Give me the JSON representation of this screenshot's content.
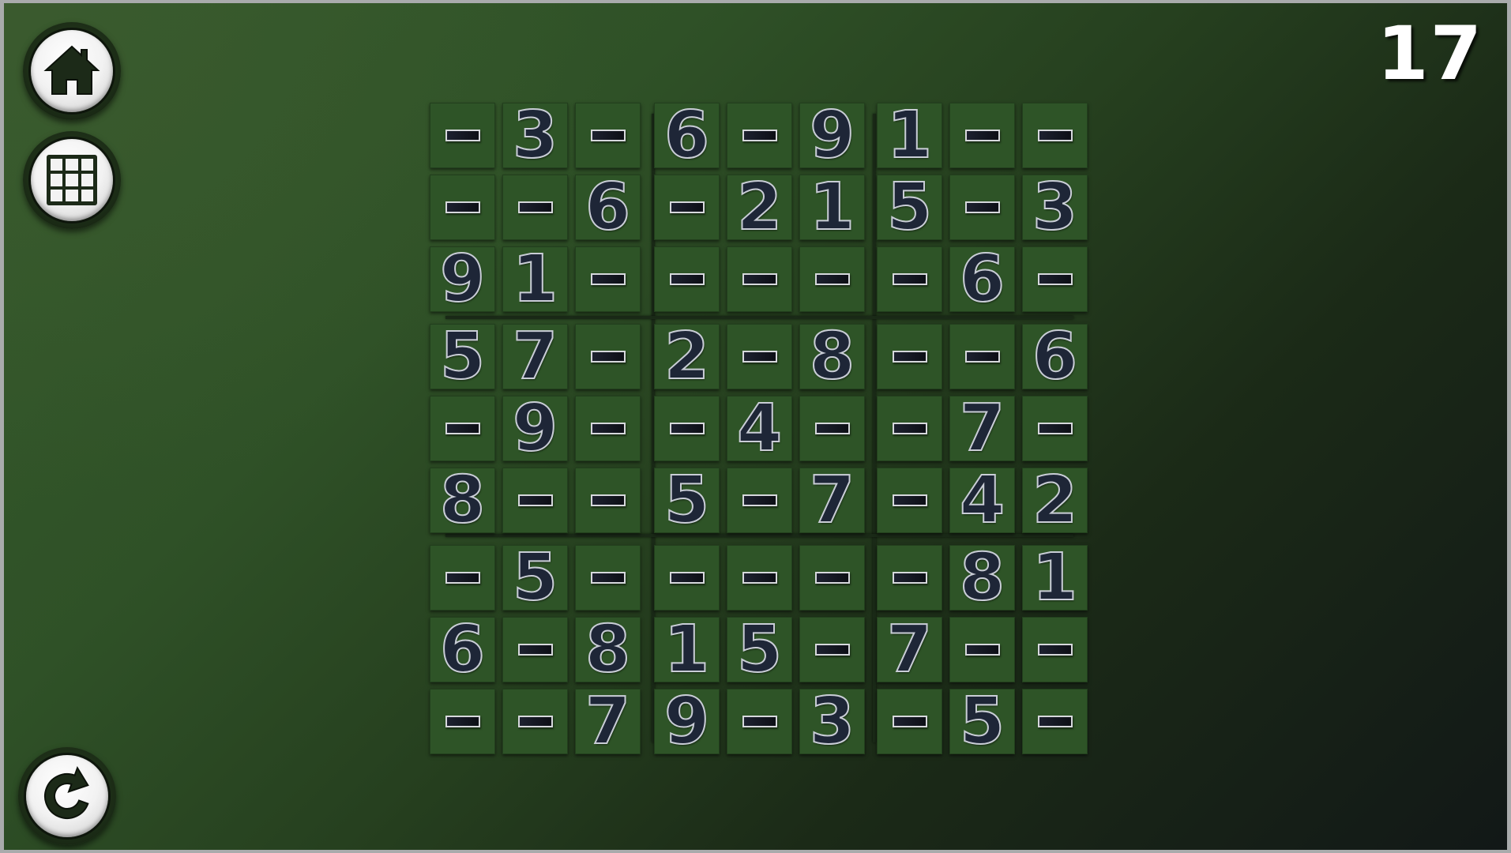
{
  "game": {
    "counter": "17",
    "board": [
      [
        "",
        "3",
        "",
        "6",
        "",
        "9",
        "1",
        "",
        ""
      ],
      [
        "",
        "",
        "6",
        "",
        "2",
        "1",
        "5",
        "",
        "3"
      ],
      [
        "9",
        "1",
        "",
        "",
        "",
        "",
        "",
        "6",
        ""
      ],
      [
        "5",
        "7",
        "",
        "2",
        "",
        "8",
        "",
        "",
        "6"
      ],
      [
        "",
        "9",
        "",
        "",
        "4",
        "",
        "",
        "7",
        ""
      ],
      [
        "8",
        "",
        "",
        "5",
        "",
        "7",
        "",
        "4",
        "2"
      ],
      [
        "",
        "5",
        "",
        "",
        "",
        "",
        "",
        "8",
        "1"
      ],
      [
        "6",
        "",
        "8",
        "1",
        "5",
        "",
        "7",
        "",
        ""
      ],
      [
        "",
        "",
        "7",
        "9",
        "",
        "3",
        "",
        "5",
        ""
      ]
    ]
  },
  "controls": {
    "home_icon": "home-icon",
    "grid_icon": "grid-icon",
    "restart_icon": "restart-icon"
  },
  "colors": {
    "cell_bg": "#2e5427",
    "digit_fill": "#1e2637",
    "digit_outline": "#c9cdd6",
    "counter_text": "#ffffff"
  }
}
